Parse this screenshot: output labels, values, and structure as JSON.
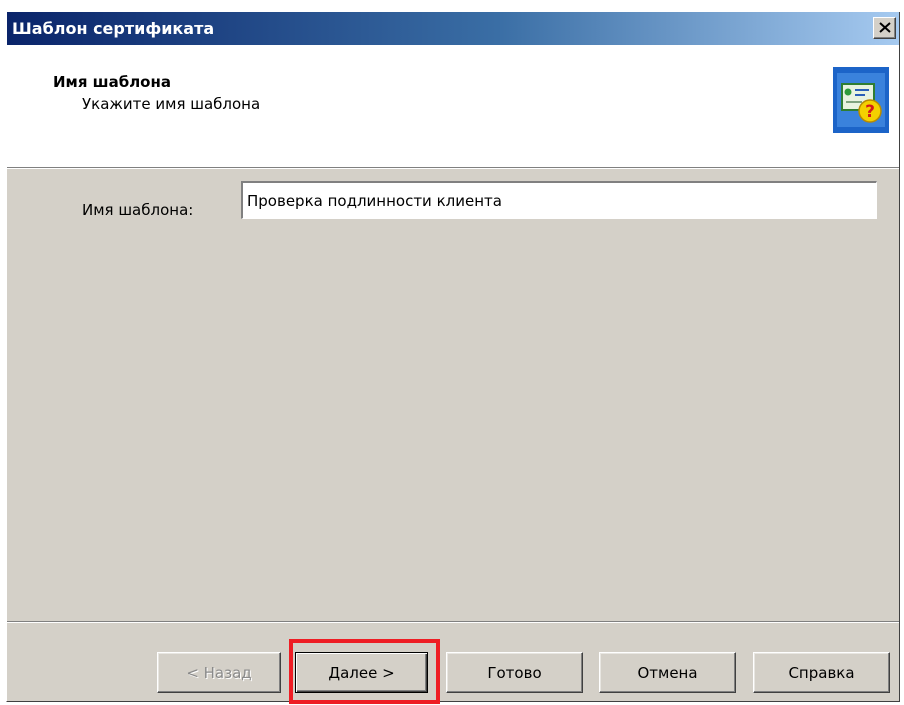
{
  "window": {
    "title": "Шаблон сертификата",
    "close_icon": "close-icon"
  },
  "header": {
    "title": "Имя шаблона",
    "subtitle": "Укажите имя шаблона",
    "icon": "certificate-question-icon"
  },
  "form": {
    "name_label": "Имя шаблона:",
    "name_value": "Проверка подлинности клиента"
  },
  "buttons": {
    "back": "< Назад",
    "next": "Далее >",
    "finish": "Готово",
    "cancel": "Отмена",
    "help": "Справка"
  },
  "annotation": {
    "highlight_color": "#ee1d24",
    "highlighted_button": "next"
  },
  "colors": {
    "titlebar_start": "#0a246a",
    "titlebar_end": "#a6caf0",
    "dialog_bg": "#d4d0c8",
    "icon_bg": "#1c64c8"
  }
}
